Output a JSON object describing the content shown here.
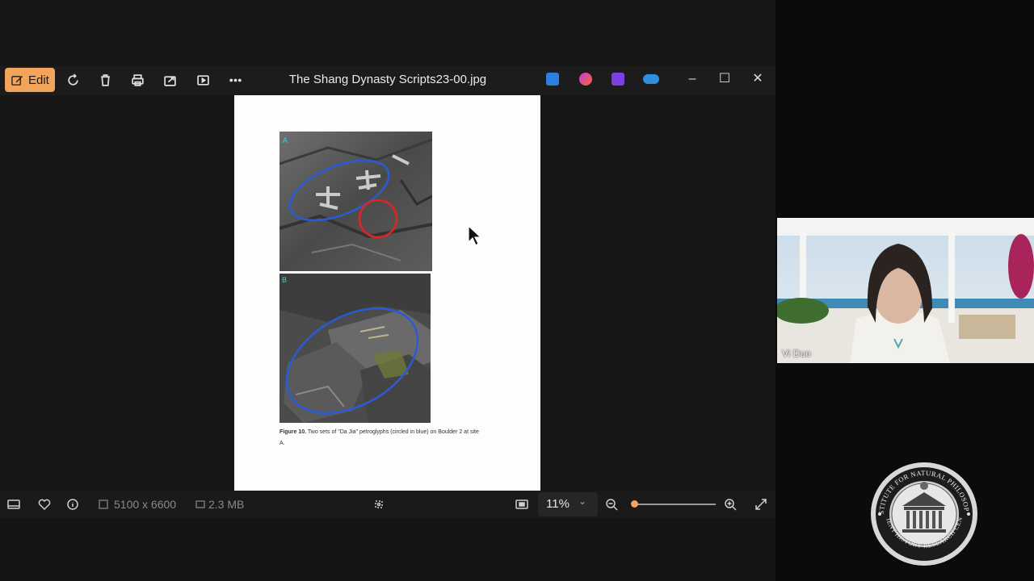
{
  "toolbar": {
    "edit_label": "Edit",
    "icons": [
      "rotate-icon",
      "delete-icon",
      "print-icon",
      "share-icon",
      "slideshow-icon",
      "more-icon"
    ]
  },
  "window": {
    "title": "The Shang Dynasty Scripts23-00.jpg",
    "app_icons": [
      "photos-app-icon",
      "copilot-icon",
      "clipchamp-icon",
      "onedrive-icon"
    ],
    "controls": [
      "minimize-icon",
      "maximize-icon",
      "close-icon"
    ]
  },
  "document": {
    "photo_label_top": "A",
    "photo_label_bottom": "B",
    "caption_bold": "Figure 10.",
    "caption_rest": " Two sets of \"Da Jia\" petroglyphs (circled in blue) on Boulder 2 at site",
    "caption_line2": "A."
  },
  "statusbar": {
    "dimensions": "5100 x 6600",
    "file_size": "2.3 MB",
    "zoom": "11%",
    "zoom_fraction": 0.03
  },
  "participant": {
    "name": "Vi Duo"
  },
  "colors": {
    "accent": "#f2a55a",
    "circle_blue": "#2a5bd7",
    "circle_red": "#e02424"
  }
}
